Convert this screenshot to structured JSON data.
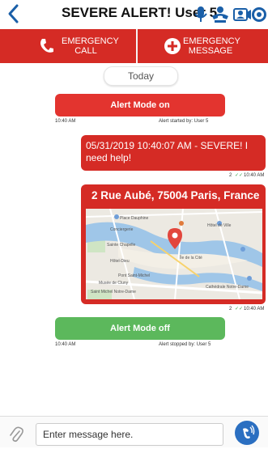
{
  "header": {
    "title": "SEVERE ALERT! User 5",
    "back_icon": "chevron-left-icon",
    "icons": [
      "microphone-icon",
      "group-call-icon",
      "user-card-icon",
      "location-badge-icon"
    ],
    "accent": "#1a5fa8"
  },
  "emergency": {
    "call_label": "EMERGENCY CALL",
    "message_label": "EMERGENCY MESSAGE",
    "color": "#d52b25"
  },
  "chat": {
    "date_divider": "Today",
    "alert_on": {
      "label": "Alert Mode on",
      "time": "10:40 AM",
      "meta": "Alert started by: User 5",
      "color": "#e3342f"
    },
    "message1": {
      "text": "05/31/2019 10:40:07 AM - SEVERE! I need help!",
      "read_count": "2",
      "time": "10:40 AM"
    },
    "location": {
      "address": "2 Rue Aubé, 75004 Paris, France",
      "read_count": "2",
      "time": "10:40 AM",
      "map_labels": {
        "place_dauphine": "Place Dauphine",
        "conciergerie": "Conciergerie",
        "sainte_chapelle": "Sainte Chapelle",
        "hotel_dieu": "Hôtel-Dieu",
        "ile_de_la_cite": "Île de la Cité",
        "point_saint_michel": "Pont Saint-Michel",
        "musee": "Musée de Cluny",
        "saint_michel_nd": "Saint Michel Notre-Dame",
        "cathedrale": "Cathédrale Notre-Dame",
        "hotel_ville": "Hôtel de Ville"
      }
    },
    "alert_off": {
      "label": "Alert Mode off",
      "time": "10:40 AM",
      "meta": "Alert stopped by: User 5",
      "color": "#5cb85c"
    }
  },
  "composer": {
    "placeholder": "Enter message here.",
    "attach_icon": "paperclip-icon",
    "send_icon": "send-voice-icon"
  }
}
